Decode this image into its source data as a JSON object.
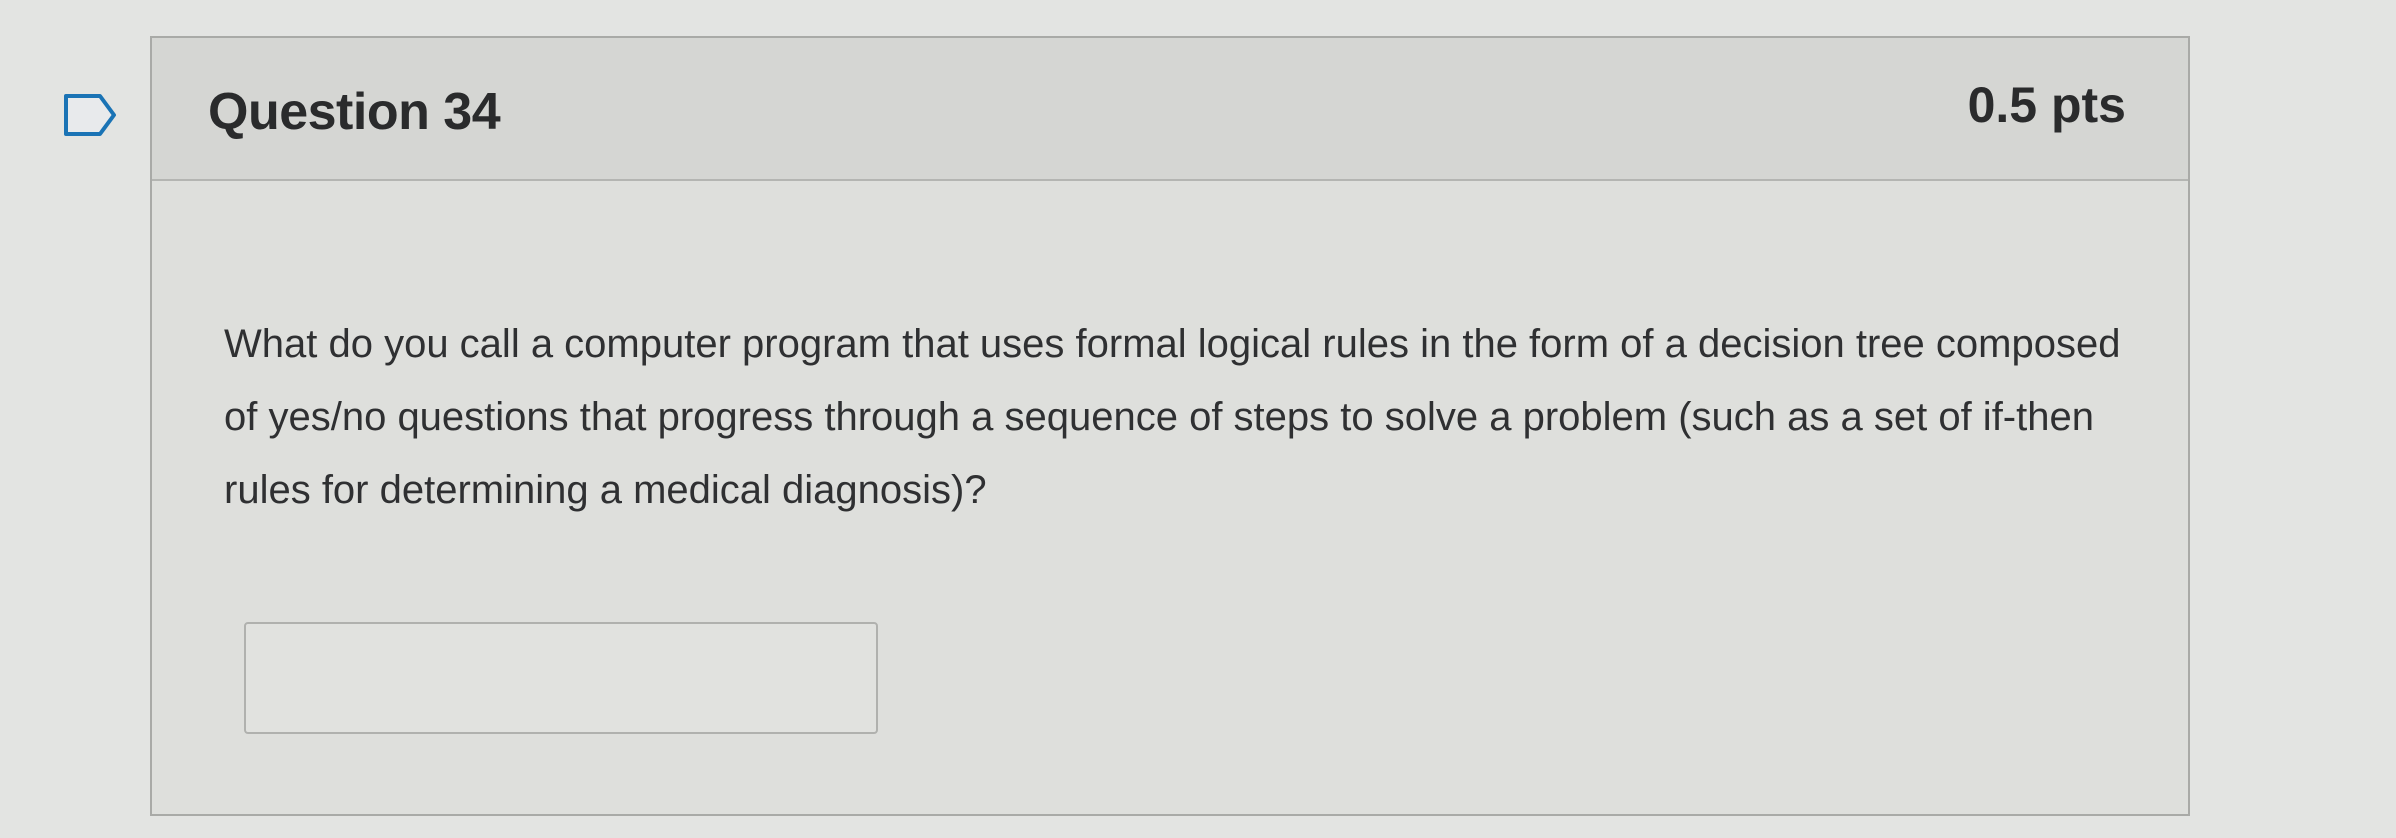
{
  "question": {
    "title": "Question 34",
    "points": "0.5 pts",
    "text": "What do you call a computer program that uses formal logical rules in the form of a decision tree composed of yes/no questions that progress through a sequence of steps to solve a problem (such as a set of if-then rules for determining a medical diagnosis)?",
    "answer": {
      "value": "",
      "placeholder": ""
    }
  },
  "colors": {
    "text": "#2a2b2c",
    "flag_accent": "#1a73b5",
    "card_border": "#a9aaa7",
    "header_bg": "#d5d6d3"
  },
  "icons": {
    "flag": "bookmark-flag-icon"
  }
}
